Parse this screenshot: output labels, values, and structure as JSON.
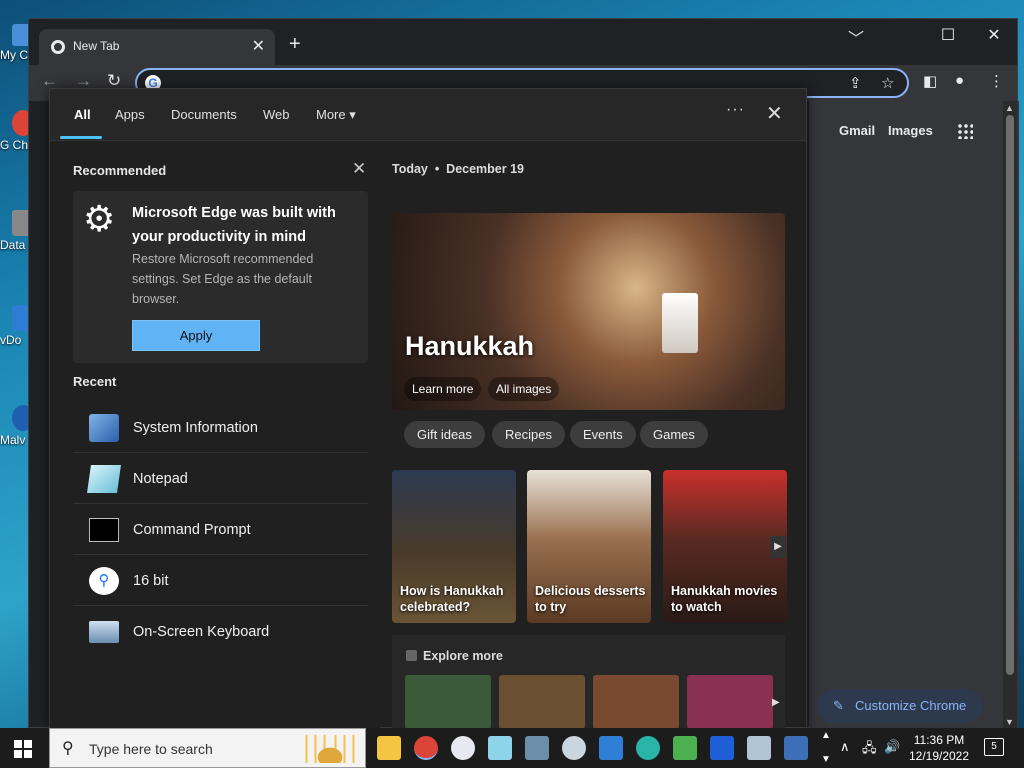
{
  "desktop": {
    "icons": [
      {
        "label": "My C",
        "color": "#4a90d9"
      },
      {
        "label": "G Ch",
        "color": "#db4437"
      },
      {
        "label": "Data",
        "color": "#888888"
      },
      {
        "label": "vDo",
        "color": "#2d7dd2"
      },
      {
        "label": "Malv",
        "color": "#1f5fb0"
      }
    ]
  },
  "chrome": {
    "tab_title": "New Tab",
    "tab_close": "✕",
    "new_tab": "+",
    "window_controls": {
      "min": "﹀",
      "max": "☐",
      "close": "✕"
    },
    "omnibox_value": "",
    "ntp": {
      "gmail": "Gmail",
      "images": "Images",
      "customize": "Customize Chrome"
    }
  },
  "panel": {
    "tabs": [
      "All",
      "Apps",
      "Documents",
      "Web",
      "More"
    ],
    "more_caret": "▾",
    "dots": "···",
    "close": "✕",
    "recommended_heading": "Recommended",
    "rec_card": {
      "title": "Microsoft Edge was built with your productivity in mind",
      "desc": "Restore Microsoft recommended settings. Set Edge as the default browser.",
      "apply": "Apply"
    },
    "recent_heading": "Recent",
    "recent": [
      {
        "label": "System Information",
        "icon": "system-information-icon"
      },
      {
        "label": "Notepad",
        "icon": "notepad-icon"
      },
      {
        "label": "Command Prompt",
        "icon": "command-prompt-icon"
      },
      {
        "label": "16 bit",
        "icon": "search-result-icon"
      },
      {
        "label": "On-Screen Keyboard",
        "icon": "on-screen-keyboard-icon"
      }
    ],
    "today": "Today",
    "date": "December 19",
    "hero": {
      "title": "Hanukkah",
      "learn_more": "Learn more",
      "all_images": "All images"
    },
    "chips": [
      "Gift ideas",
      "Recipes",
      "Events",
      "Games"
    ],
    "cards": [
      {
        "label": "How is Hanukkah celebrated?",
        "bg": "#4a3b2a"
      },
      {
        "label": "Delicious desserts to try",
        "bg": "#7a5a3c"
      },
      {
        "label": "Hanukkah movies to watch",
        "bg": "#5a2a22"
      }
    ],
    "explore_heading": "Explore more",
    "explore_thumbs": [
      "#3a5a3a",
      "#6a5030",
      "#7a4a30",
      "#8a3050"
    ]
  },
  "taskbar": {
    "search_placeholder": "Type here to search",
    "time": "11:36 PM",
    "date": "12/19/2022",
    "notifications": "5",
    "pinned": [
      {
        "name": "file-explorer-icon",
        "color": "#f4c542"
      },
      {
        "name": "chrome-icon",
        "color": "#db4437"
      },
      {
        "name": "itunes-icon",
        "color": "#e8e8f0"
      },
      {
        "name": "notepad-icon",
        "color": "#8ed4e8"
      },
      {
        "name": "calculator-icon",
        "color": "#6b8fa8"
      },
      {
        "name": "paint-icon",
        "color": "#c9d6e0"
      },
      {
        "name": "store-icon",
        "color": "#2f7fd6"
      },
      {
        "name": "edge-icon",
        "color": "#2bb5a8"
      },
      {
        "name": "task-manager-icon",
        "color": "#4caf50"
      },
      {
        "name": "malwarebytes-icon",
        "color": "#1e5fd8"
      },
      {
        "name": "remote-desktop-icon",
        "color": "#b0c4d4"
      },
      {
        "name": "system-information-icon",
        "color": "#3d6fb8"
      }
    ]
  }
}
